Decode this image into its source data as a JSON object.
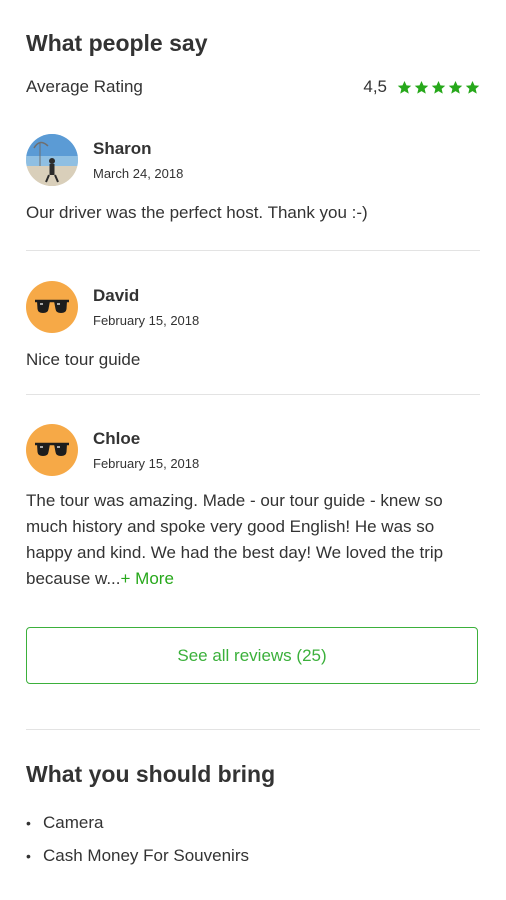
{
  "section_title": "What people say",
  "rating": {
    "label": "Average Rating",
    "value": "4,5",
    "stars": 5,
    "star_color": "#27a81b"
  },
  "reviews": [
    {
      "name": "Sharon",
      "date": "March 24, 2018",
      "text": "Our driver was the perfect host. Thank you :-)",
      "avatar": "photo"
    },
    {
      "name": "David",
      "date": "February 15, 2018",
      "text": "Nice tour guide",
      "avatar": "sunglasses-icon"
    },
    {
      "name": "Chloe",
      "date": "February 15, 2018",
      "text": "The tour was amazing. Made - our tour guide - knew so much history and spoke very good English! He was so happy and kind. We had the best day! We loved the trip because w...",
      "more": "+ More",
      "avatar": "sunglasses-icon"
    }
  ],
  "see_all_label": "See all reviews (25)",
  "bring": {
    "title": "What you should bring",
    "items": [
      "Camera",
      "Cash Money For Souvenirs"
    ]
  },
  "colors": {
    "accent": "#27a81b",
    "avatar_bg": "#f6a947",
    "text": "#333333"
  }
}
